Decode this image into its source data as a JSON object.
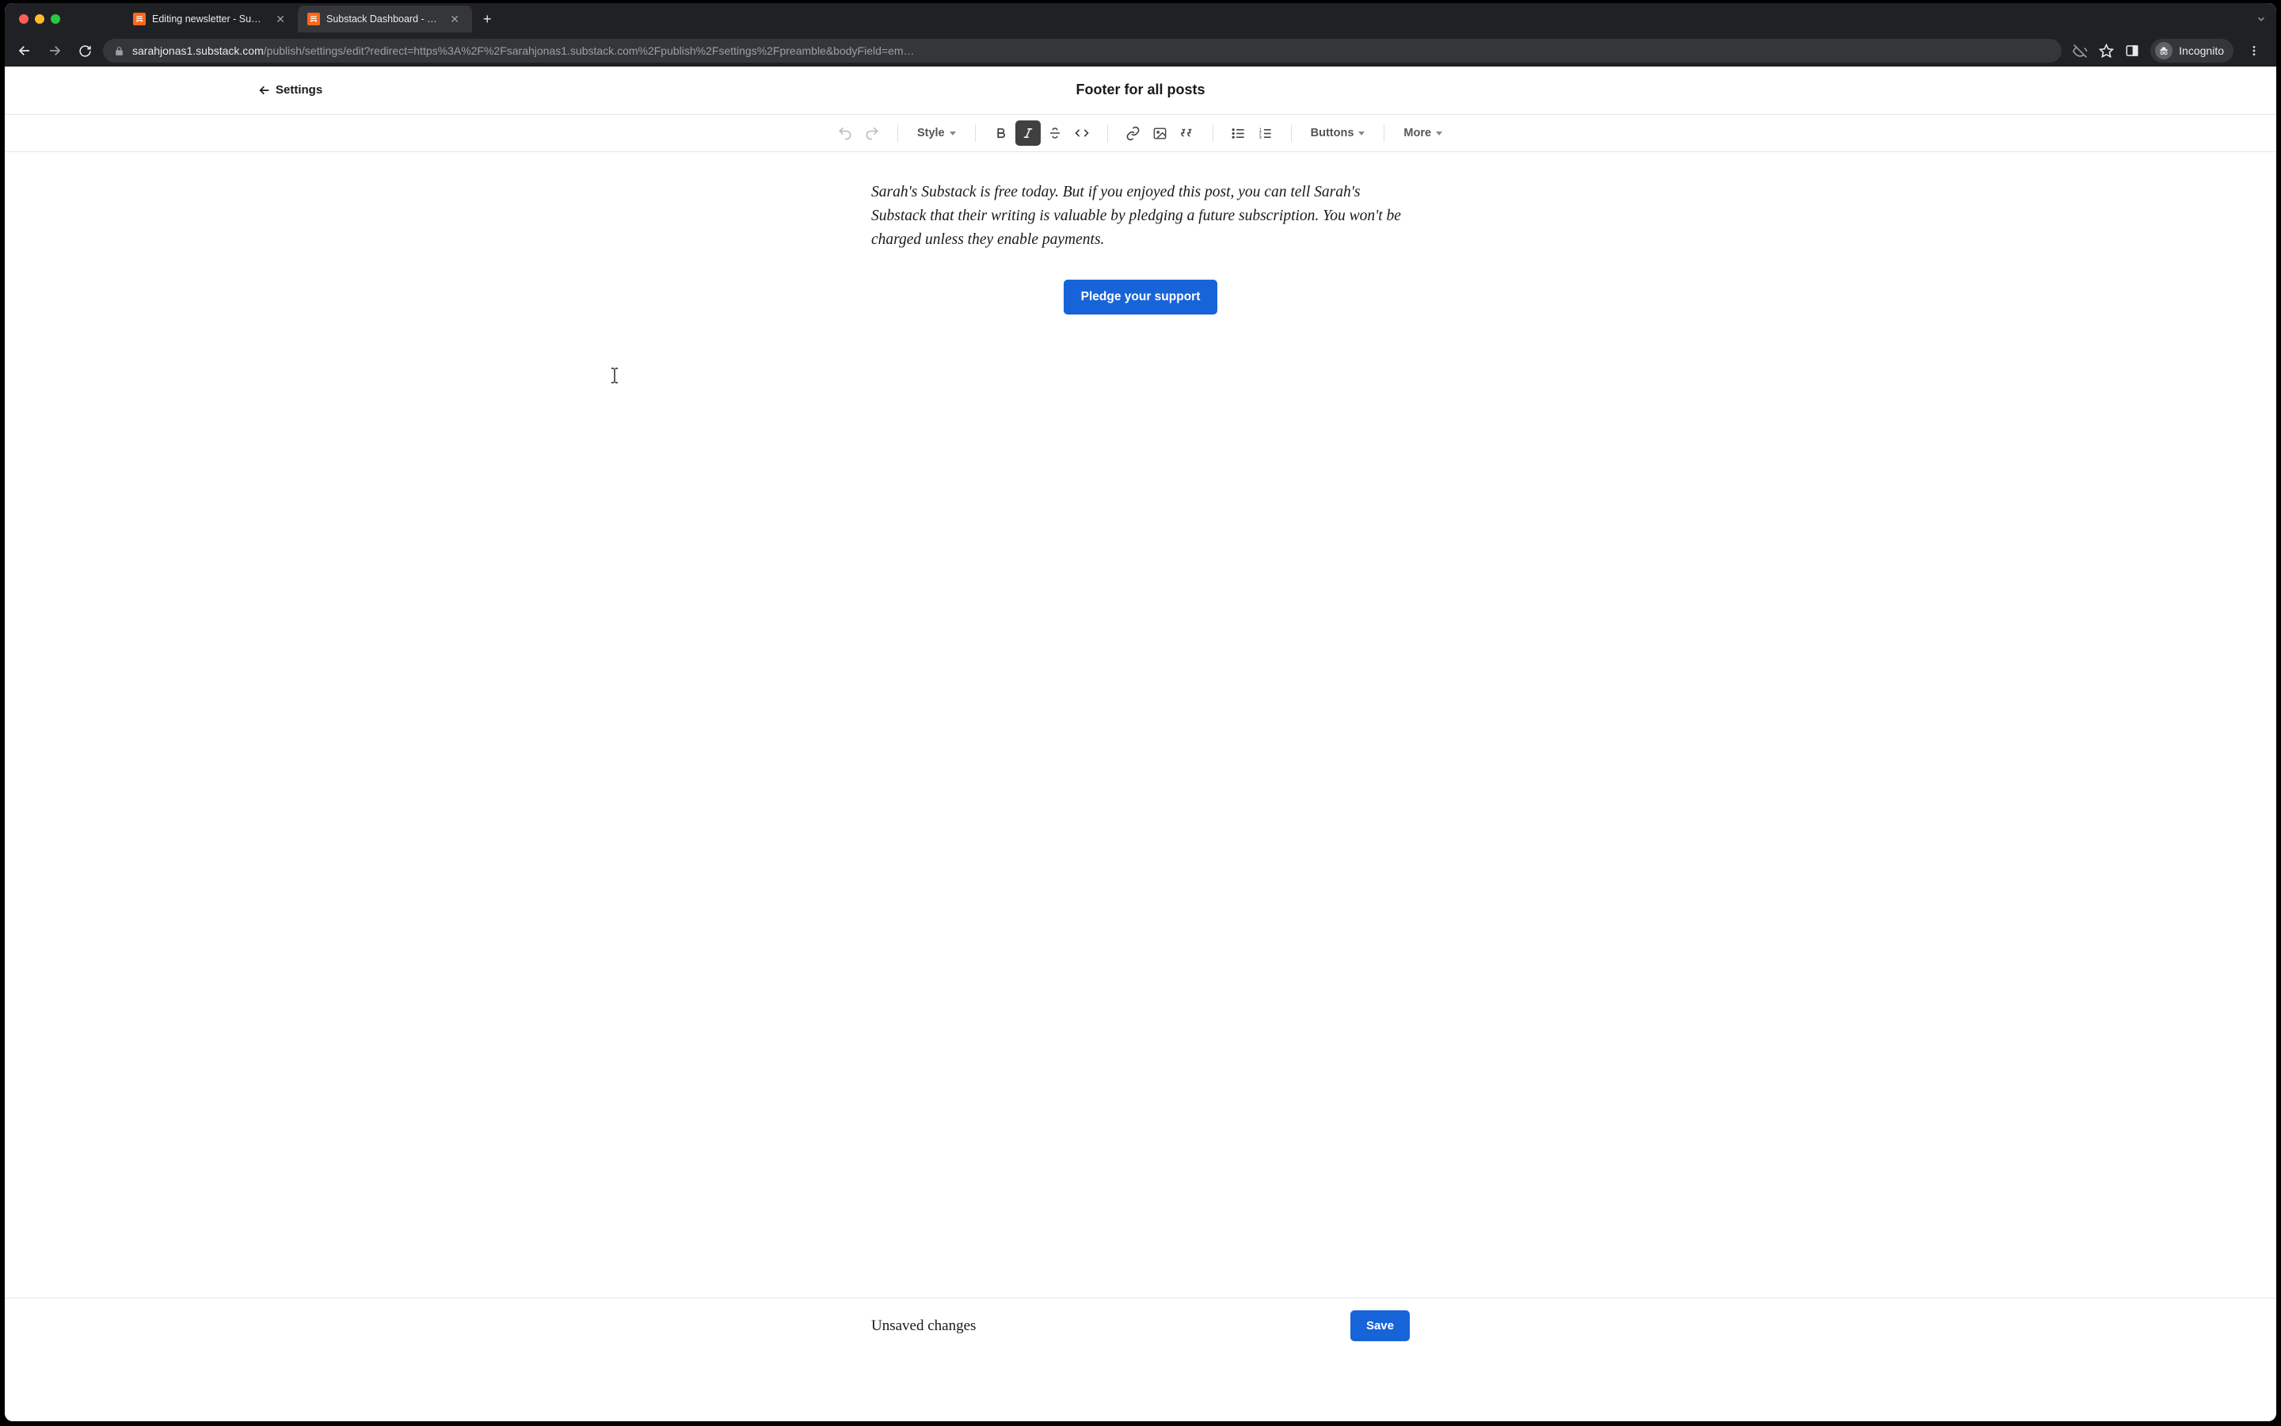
{
  "browser": {
    "tabs": [
      {
        "title": "Editing newsletter - Substack",
        "active": false
      },
      {
        "title": "Substack Dashboard - Sarah's",
        "active": true
      }
    ],
    "url_host": "sarahjonas1.substack.com",
    "url_path": "/publish/settings/edit?redirect=https%3A%2F%2Fsarahjonas1.substack.com%2Fpublish%2Fsettings%2Fpreamble&bodyField=em…",
    "incognito_label": "Incognito"
  },
  "header": {
    "back_label": "Settings",
    "page_title": "Footer for all posts"
  },
  "toolbar": {
    "style_label": "Style",
    "buttons_label": "Buttons",
    "more_label": "More"
  },
  "editor": {
    "body_text": "Sarah's Substack is free today. But if you enjoyed this post, you can tell Sarah's Substack that their writing is valuable by pledging a future subscription. You won't be charged unless they enable payments.",
    "cta_label": "Pledge your support"
  },
  "footer": {
    "status_text": "Unsaved changes",
    "save_label": "Save"
  }
}
